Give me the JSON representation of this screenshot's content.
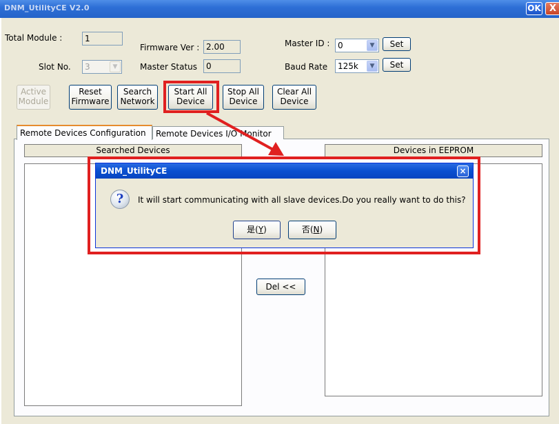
{
  "window": {
    "title": "DNM_UtilityCE V2.0",
    "ok_label": "OK",
    "close_label": "X"
  },
  "form": {
    "total_module_label": "Total Module :",
    "total_module_value": "1",
    "slot_no_label": "Slot No.",
    "slot_no_value": "3",
    "firmware_ver_label": "Firmware Ver :",
    "firmware_ver_value": "2.00",
    "master_status_label": "Master Status",
    "master_status_value": "0",
    "master_id_label": "Master ID :",
    "master_id_value": "0",
    "baud_rate_label": "Baud Rate",
    "baud_rate_value": "125k",
    "set_label": "Set"
  },
  "buttons": {
    "active_module": [
      "Active",
      "Module"
    ],
    "reset_firmware": [
      "Reset",
      "Firmware"
    ],
    "search_network": [
      "Search",
      "Network"
    ],
    "start_all_device": [
      "Start All",
      "Device"
    ],
    "stop_all_device": [
      "Stop All",
      "Device"
    ],
    "clear_all_device": [
      "Clear All",
      "Device"
    ]
  },
  "tabs": [
    {
      "label": "Remote Devices Configuration"
    },
    {
      "label": "Remote Devices I/O Monitor"
    }
  ],
  "panel": {
    "searched_devices_header": "Searched Devices",
    "devices_in_eeprom_header": "Devices in EEPROM",
    "del_label": "Del <<"
  },
  "dialog": {
    "title": "DNM_UtilityCE",
    "close_label": "×",
    "icon_glyph": "?",
    "message": "It will start communicating with all slave devices.Do you really want to do this?",
    "yes_main": "是(",
    "yes_key": "Y",
    "no_main": "否(",
    "no_key": "N",
    "paren_close": ")"
  },
  "colors": {
    "title_bar": "#2463c9",
    "client_bg": "#ece9d8",
    "highlight": "#e02020",
    "dialog_title": "#0a4fd0"
  },
  "icons": [
    "question-icon",
    "combo-arrow-icon",
    "close-icon"
  ]
}
